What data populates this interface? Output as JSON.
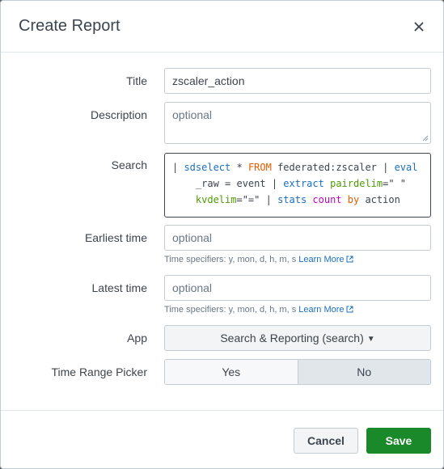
{
  "dialog": {
    "title": "Create Report",
    "close_icon": "close-icon"
  },
  "form": {
    "title": {
      "label": "Title",
      "value": "zscaler_action"
    },
    "description": {
      "label": "Description",
      "placeholder": "optional"
    },
    "search": {
      "label": "Search",
      "tokens_line1": [
        "| ",
        "sdselect",
        " * ",
        "FROM",
        " federated:zscaler | ",
        "eval"
      ],
      "tokens_line2": [
        "    _raw = event | ",
        "extract",
        " ",
        "pairdelim",
        "=\" \""
      ],
      "tokens_line3": [
        "    ",
        "kvdelim",
        "=\"=\" | ",
        "stats",
        " ",
        "count",
        " ",
        "by",
        " action"
      ]
    },
    "earliest_time": {
      "label": "Earliest time",
      "placeholder": "optional",
      "help": "Time specifiers: y, mon, d, h, m, s",
      "help_link": "Learn More"
    },
    "latest_time": {
      "label": "Latest time",
      "placeholder": "optional",
      "help": "Time specifiers: y, mon, d, h, m, s",
      "help_link": "Learn More"
    },
    "app": {
      "label": "App",
      "value": "Search & Reporting (search)"
    },
    "time_range_picker": {
      "label": "Time Range Picker",
      "options": [
        "Yes",
        "No"
      ],
      "selected": "No"
    }
  },
  "footer": {
    "cancel_label": "Cancel",
    "save_label": "Save"
  },
  "colors": {
    "save_button": "#1a8929",
    "link": "#1a6fbf",
    "search_command": "#1a6fbf",
    "search_keyword": "#e65c00",
    "search_argument": "#4e9a06",
    "search_function": "#c100c1"
  }
}
